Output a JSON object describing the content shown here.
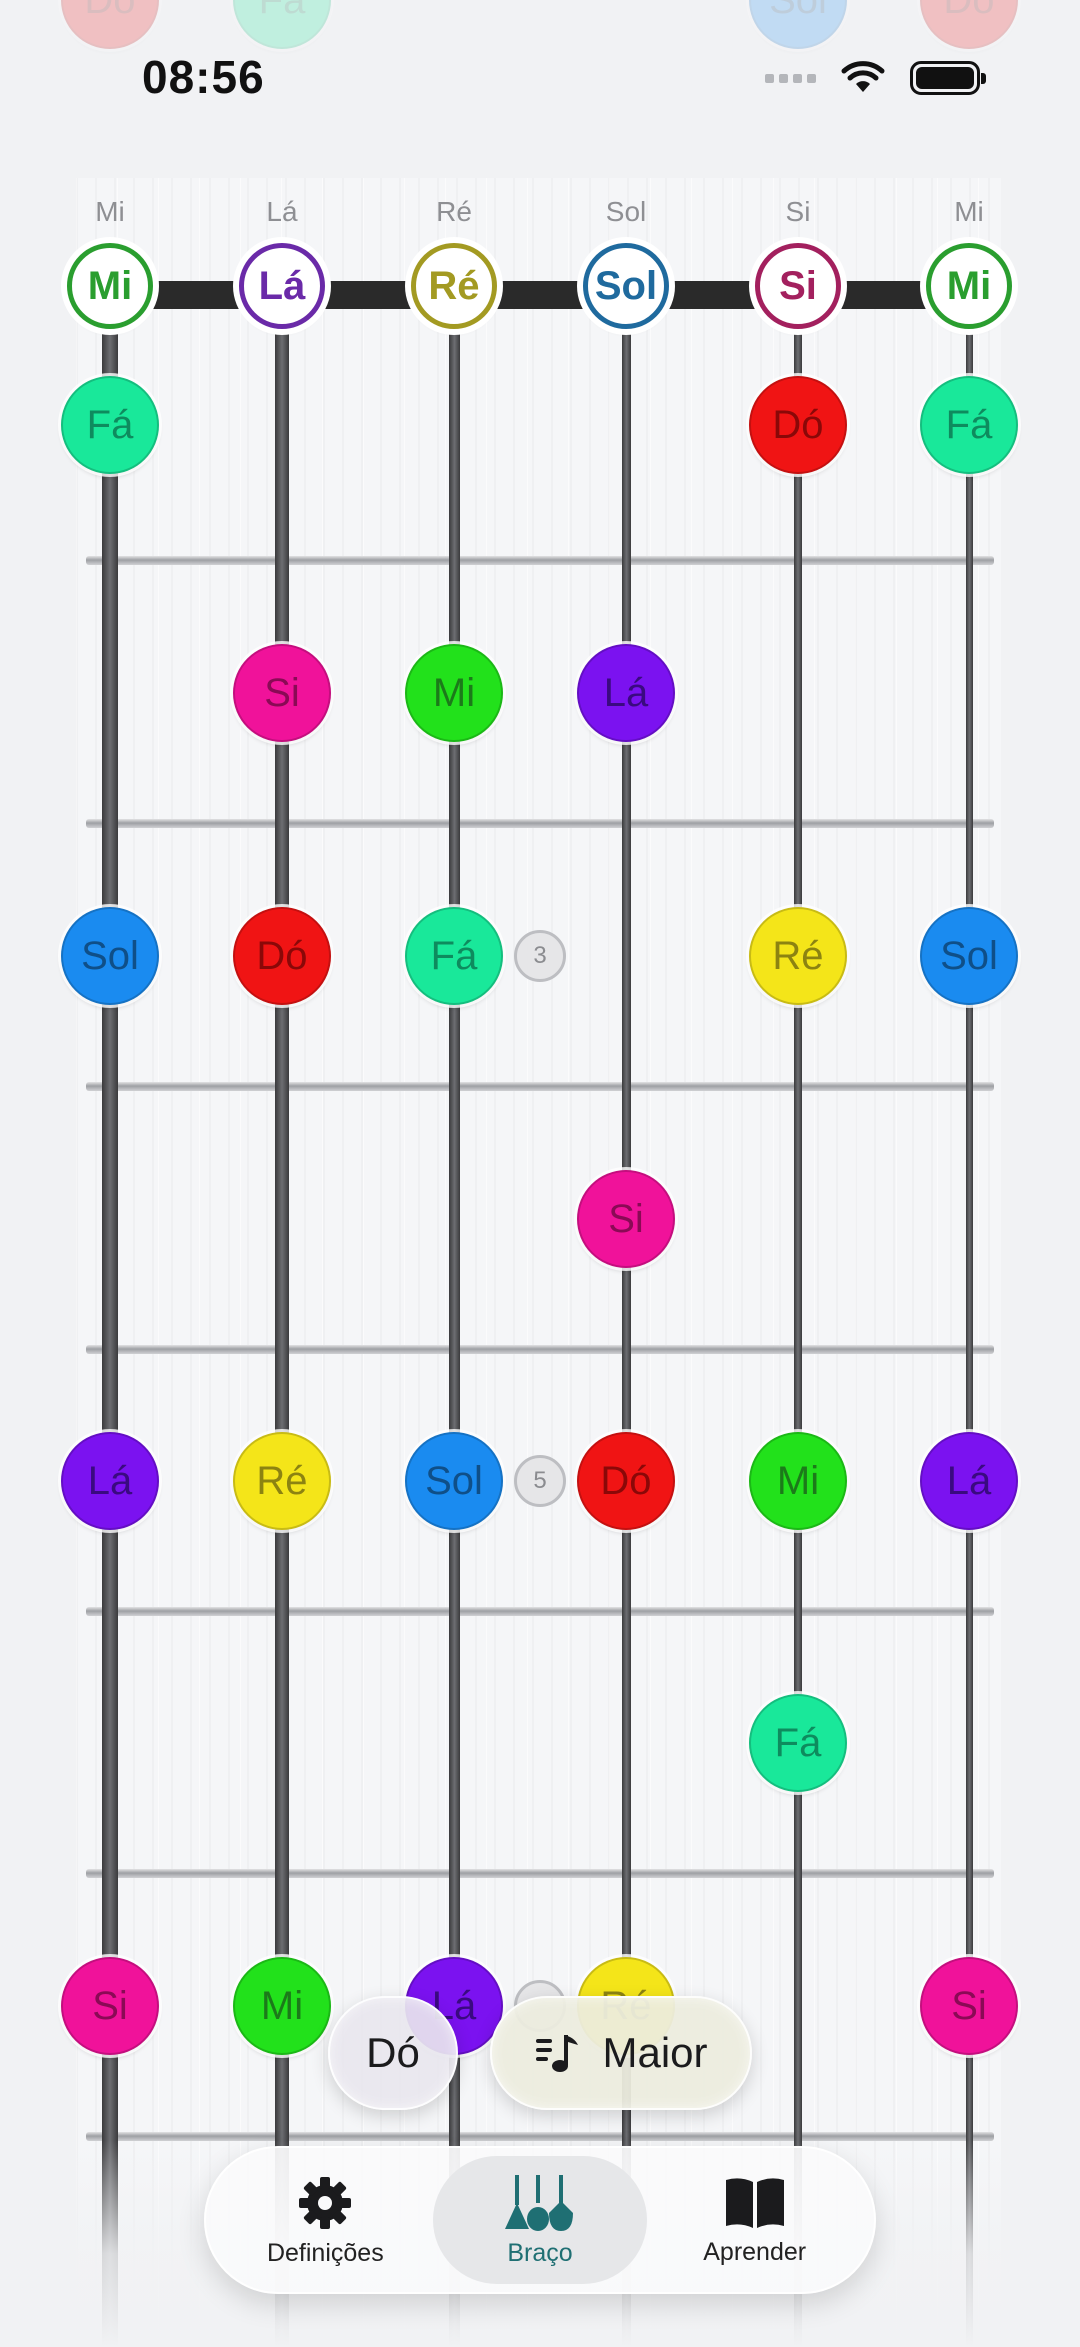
{
  "status_bar": {
    "time": "08:56"
  },
  "colors": {
    "Mi": "#22e11b",
    "Fá": "#19e89a",
    "Sol": "#1a8bf0",
    "Lá": "#7b12f0",
    "Si": "#f0129a",
    "Dó": "#f01414",
    "Ré": "#f4e519"
  },
  "open_string_ring_colors": [
    "#2a9e2f",
    "#6a2aa8",
    "#a39a22",
    "#1f6a9e",
    "#a3205e",
    "#2a9e2f"
  ],
  "strings": {
    "labels": [
      "Mi",
      "Lá",
      "Ré",
      "Sol",
      "Si",
      "Mi"
    ],
    "open_notes": [
      "Mi",
      "Lá",
      "Ré",
      "Sol",
      "Si",
      "Mi"
    ]
  },
  "fretboard": {
    "notes": [
      {
        "fret": 1,
        "string": 0,
        "note": "Fá"
      },
      {
        "fret": 1,
        "string": 4,
        "note": "Dó"
      },
      {
        "fret": 1,
        "string": 5,
        "note": "Fá"
      },
      {
        "fret": 2,
        "string": 1,
        "note": "Si"
      },
      {
        "fret": 2,
        "string": 2,
        "note": "Mi"
      },
      {
        "fret": 2,
        "string": 3,
        "note": "Lá"
      },
      {
        "fret": 3,
        "string": 0,
        "note": "Sol"
      },
      {
        "fret": 3,
        "string": 1,
        "note": "Dó"
      },
      {
        "fret": 3,
        "string": 2,
        "note": "Fá"
      },
      {
        "fret": 3,
        "string": 4,
        "note": "Ré"
      },
      {
        "fret": 3,
        "string": 5,
        "note": "Sol"
      },
      {
        "fret": 4,
        "string": 3,
        "note": "Si"
      },
      {
        "fret": 5,
        "string": 0,
        "note": "Lá"
      },
      {
        "fret": 5,
        "string": 1,
        "note": "Ré"
      },
      {
        "fret": 5,
        "string": 2,
        "note": "Sol"
      },
      {
        "fret": 5,
        "string": 3,
        "note": "Dó"
      },
      {
        "fret": 5,
        "string": 4,
        "note": "Mi"
      },
      {
        "fret": 5,
        "string": 5,
        "note": "Lá"
      },
      {
        "fret": 6,
        "string": 4,
        "note": "Fá"
      },
      {
        "fret": 7,
        "string": 0,
        "note": "Si"
      },
      {
        "fret": 7,
        "string": 1,
        "note": "Mi"
      },
      {
        "fret": 7,
        "string": 2,
        "note": "Lá"
      },
      {
        "fret": 7,
        "string": 3,
        "note": "Ré"
      },
      {
        "fret": 7,
        "string": 5,
        "note": "Si"
      },
      {
        "fret": 8,
        "string": 0,
        "note": "Dó",
        "faded": true
      },
      {
        "fret": 8,
        "string": 1,
        "note": "Fá",
        "faded": true
      },
      {
        "fret": 8,
        "string": 4,
        "note": "Sol",
        "faded": true
      },
      {
        "fret": 8,
        "string": 5,
        "note": "Dó",
        "faded": true
      }
    ],
    "fret_markers": [
      {
        "fret": 3,
        "label": "3"
      },
      {
        "fret": 5,
        "label": "5"
      },
      {
        "fret": 7,
        "label": ""
      }
    ]
  },
  "selector": {
    "key_label": "Dó",
    "scale_label": "Maior"
  },
  "tabbar": {
    "tabs": [
      {
        "label": "Definições",
        "icon": "gear-icon"
      },
      {
        "label": "Braço",
        "icon": "guitars-icon",
        "active": true
      },
      {
        "label": "Aprender",
        "icon": "book-icon"
      }
    ]
  }
}
